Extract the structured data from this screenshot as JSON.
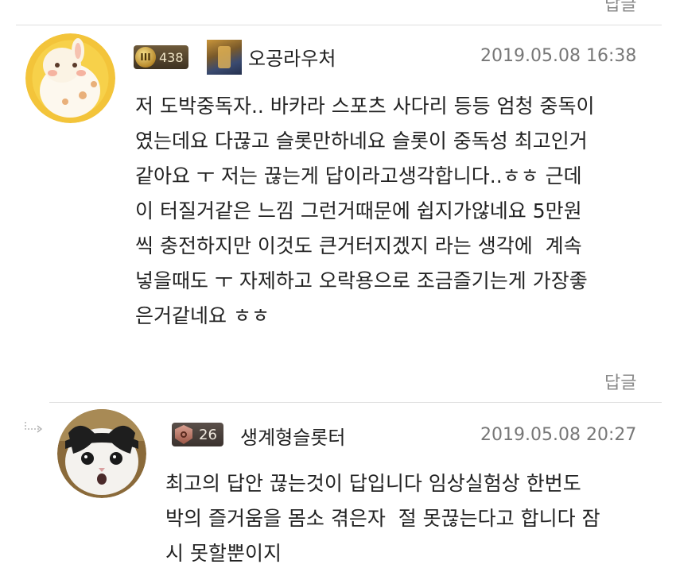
{
  "top_reply_label": "답글",
  "comments": [
    {
      "level": "438",
      "nickname": "오공라우처",
      "date": "2019.05.08 16:38",
      "lines": [
        "저 도박중독자.. 바카라 스포츠 사다리 등등 엄청 중독이",
        "였는데요 다끊고 슬롯만하네요 슬롯이 중독성 최고인거",
        "같아요 ㅜ 저는 끊는게 답이라고생각합니다..ㅎㅎ 근데",
        "이 터질거같은 느낌 그런거때문에 쉽지가않네요 5만원",
        "씩 충전하지만 이것도 큰거터지겠지 라는 생각에  계속",
        "넣을때도 ㅜ 자제하고 오락용으로 조금즐기는게 가장좋",
        "은거같네요 ㅎㅎ"
      ],
      "reply_label": "답글"
    },
    {
      "level": "26",
      "nickname": "생계형슬롯터",
      "date": "2019.05.08 20:27",
      "lines": [
        "최고의 답안 끊는것이 답입니다 임상실험상 한번도",
        "박의 즐거움을 몸소 겪은자  절 못끊는다고 합니다 잠",
        "시 못할뿐이지"
      ]
    }
  ],
  "icons": {
    "reply_arrow": "reply-arrow-icon",
    "level_emblem": "level-emblem-icon",
    "avatar1": "rabbit-avatar",
    "avatar2": "cat-avatar"
  }
}
